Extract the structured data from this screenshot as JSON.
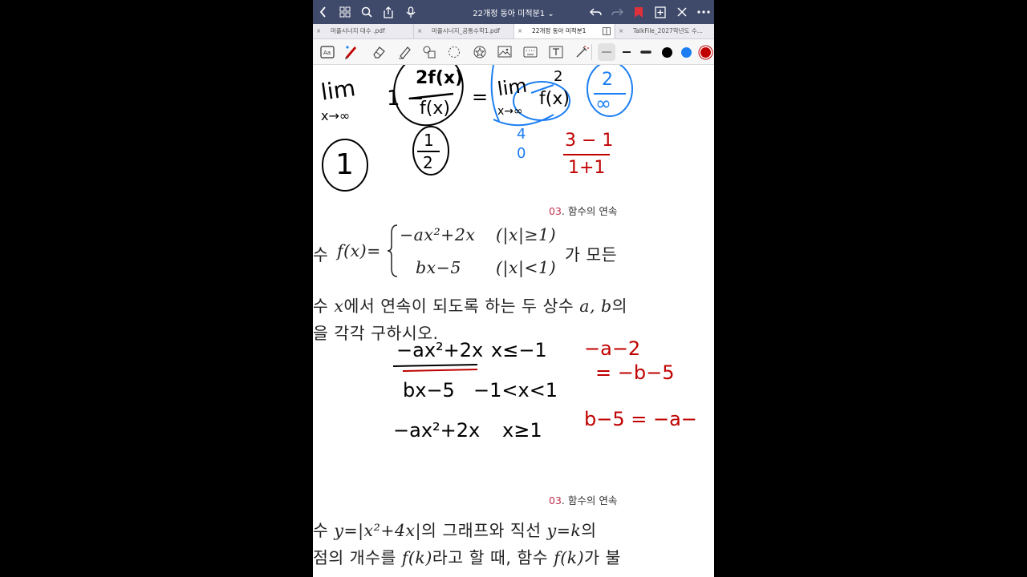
{
  "topbar": {
    "title": "22개정 동아 미적분1 ⌄",
    "icons": [
      "back-icon",
      "grid-icon",
      "search-icon",
      "share-icon",
      "microphone-icon",
      "undo-icon",
      "redo-icon",
      "bookmark-icon",
      "add-page-icon",
      "close-icon",
      "more-icon"
    ]
  },
  "tabs": [
    {
      "label": "마플시너지 대수 .pdf"
    },
    {
      "label": "마플시너지_공통수학1.pdf"
    },
    {
      "label": "22개정 동아 미적분1"
    },
    {
      "label": "TalkFile_2027학년도 수..."
    }
  ],
  "toolbar": {
    "tools": [
      "lasso-icon",
      "pen-icon",
      "eraser-icon",
      "highlighter-icon",
      "shape-icon",
      "lasso-select-icon",
      "sticker-icon",
      "image-icon",
      "keyboard-icon",
      "textbox-icon",
      "laser-pointer-icon"
    ],
    "colors": [
      "#000000",
      "#1c7ef2",
      "#c00000"
    ]
  },
  "page": {
    "section1": {
      "num": "03",
      "title": ". 함수의 연속"
    },
    "problem1": {
      "prefix": "수",
      "fx": "f(x)=",
      "case1_expr": "−ax²+2x",
      "case1_cond": "(|x|≥1)",
      "case2_expr": "bx−5",
      "case2_cond": "(|x|<1)",
      "suffix": "가 모든",
      "line2_a": "수 ",
      "line2_x": "x",
      "line2_b": "에서 연속이 되도록 하는 두 상수 ",
      "line2_ab": "a, b",
      "line2_c": "의",
      "line3": "을 각각 구하시오."
    },
    "section2": {
      "num": "03",
      "title": ". 함수의 연속"
    },
    "problem2": {
      "line1_a": "수 ",
      "line1_m": "y=|x²+4x|",
      "line1_b": "의 그래프와 직선 ",
      "line1_m2": "y=k",
      "line1_c": "의",
      "line2_a": "점의 개수를 ",
      "line2_m": "f(k)",
      "line2_b": "라고 할 때, 함수 ",
      "line2_m2": "f(k)",
      "line2_c": "가 불"
    },
    "handwriting": {
      "lim1": "lim",
      "lim1_sub": "x→∞",
      "one_minus": "1 −",
      "frac_num": "2f(x)",
      "frac_den": "f(x)",
      "eq": "=",
      "lim2": "lim",
      "lim2_sub": "x→∞",
      "frac2_num": "2",
      "frac2_den": "f(x)",
      "circ_num": "2",
      "circ_den": "∞",
      "one": "1",
      "half_num": "1",
      "half_den": "2",
      "blue_4": "4",
      "blue_0": "0",
      "red_num": "3 − 1",
      "red_den": "1+1",
      "case_a": "−ax²+2x",
      "case_a_cond": "x≤−1",
      "case_b": "bx−5",
      "case_b_cond": "−1<x<1",
      "case_c": "−ax²+2x",
      "case_c_cond": "x≥1",
      "red1": "−a−2",
      "red2": "= −b−5",
      "red3": "b−5 = −a−"
    }
  }
}
